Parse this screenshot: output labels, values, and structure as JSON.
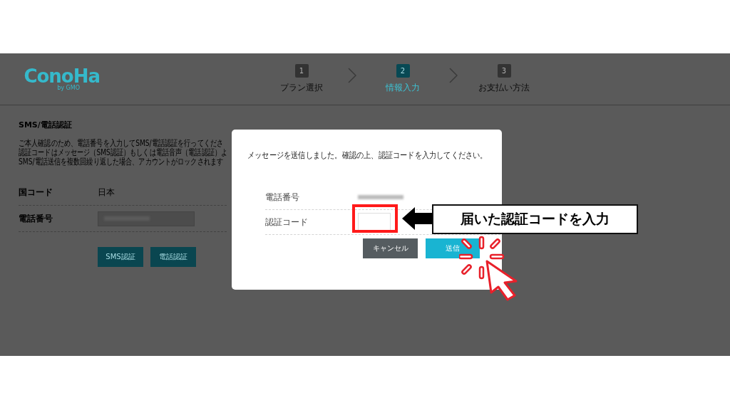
{
  "header": {
    "logo": "ConoHa",
    "logo_sub": "by GMO"
  },
  "steps": [
    {
      "number": "1",
      "label": "プラン選択",
      "selected": false
    },
    {
      "number": "2",
      "label": "情報入力",
      "selected": true
    },
    {
      "number": "3",
      "label": "お支払い方法",
      "selected": false
    }
  ],
  "section": {
    "title": "SMS/電話認証",
    "lines": [
      "ご本人確認のため、電話番号を入力してSMS/電話認証を行ってくださ",
      "認証コードはメッセージ（SMS認証）もしくは電話音声（電話認証）よ",
      "SMS/電話送信を複数回繰り返した場合、アカウントがロックされます"
    ]
  },
  "form": {
    "country_label": "国コード",
    "country_value": "日本",
    "phone_label": "電話番号"
  },
  "buttons": [
    "SMS認証",
    "電話認証"
  ],
  "modal": {
    "message": "メッセージを送信しました。確認の上、認証コードを入力してください。",
    "phone_label": "電話番号",
    "code_label": "認証コード",
    "cancel": "キャンセル",
    "submit": "送信"
  },
  "annotation": {
    "callout": "届いた認証コードを入力"
  }
}
